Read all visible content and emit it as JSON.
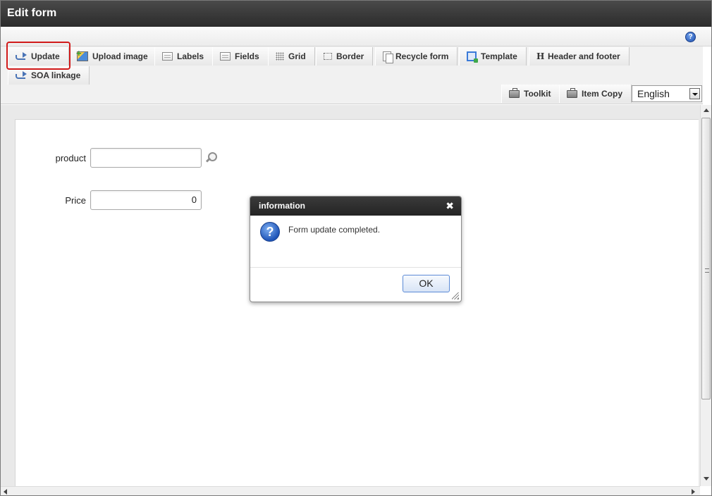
{
  "window": {
    "title": "Edit form"
  },
  "help": {
    "icon": "help-icon",
    "glyph": "?"
  },
  "toolbar": {
    "tabs": [
      {
        "label": "Update",
        "icon": "update-arrow-icon"
      },
      {
        "label": "Upload image",
        "icon": "upload-image-icon"
      },
      {
        "label": "Labels",
        "icon": "labels-icon"
      },
      {
        "label": "Fields",
        "icon": "fields-icon"
      },
      {
        "label": "Grid",
        "icon": "grid-icon"
      },
      {
        "label": "Border",
        "icon": "border-icon"
      },
      {
        "label": "Recycle form",
        "icon": "recycle-form-icon"
      },
      {
        "label": "Template",
        "icon": "template-icon"
      },
      {
        "label": "Header and footer",
        "icon": "header-footer-icon",
        "glyph": "H"
      },
      {
        "label": "SOA linkage",
        "icon": "soa-linkage-icon"
      }
    ],
    "secondary": [
      {
        "label": "Toolkit",
        "icon": "toolkit-icon"
      },
      {
        "label": "Item Copy",
        "icon": "item-copy-icon"
      }
    ],
    "language": {
      "selected": "English"
    }
  },
  "form": {
    "product": {
      "label": "product",
      "value": ""
    },
    "price": {
      "label": "Price",
      "value": "0"
    }
  },
  "dialog": {
    "title": "information",
    "close_glyph": "✖",
    "icon": "question-icon",
    "icon_glyph": "?",
    "message": "Form update completed.",
    "ok_label": "OK"
  },
  "colors": {
    "titlebar": "#2b2b2b",
    "highlight": "#d11a1a",
    "accent": "#1f55b8"
  }
}
